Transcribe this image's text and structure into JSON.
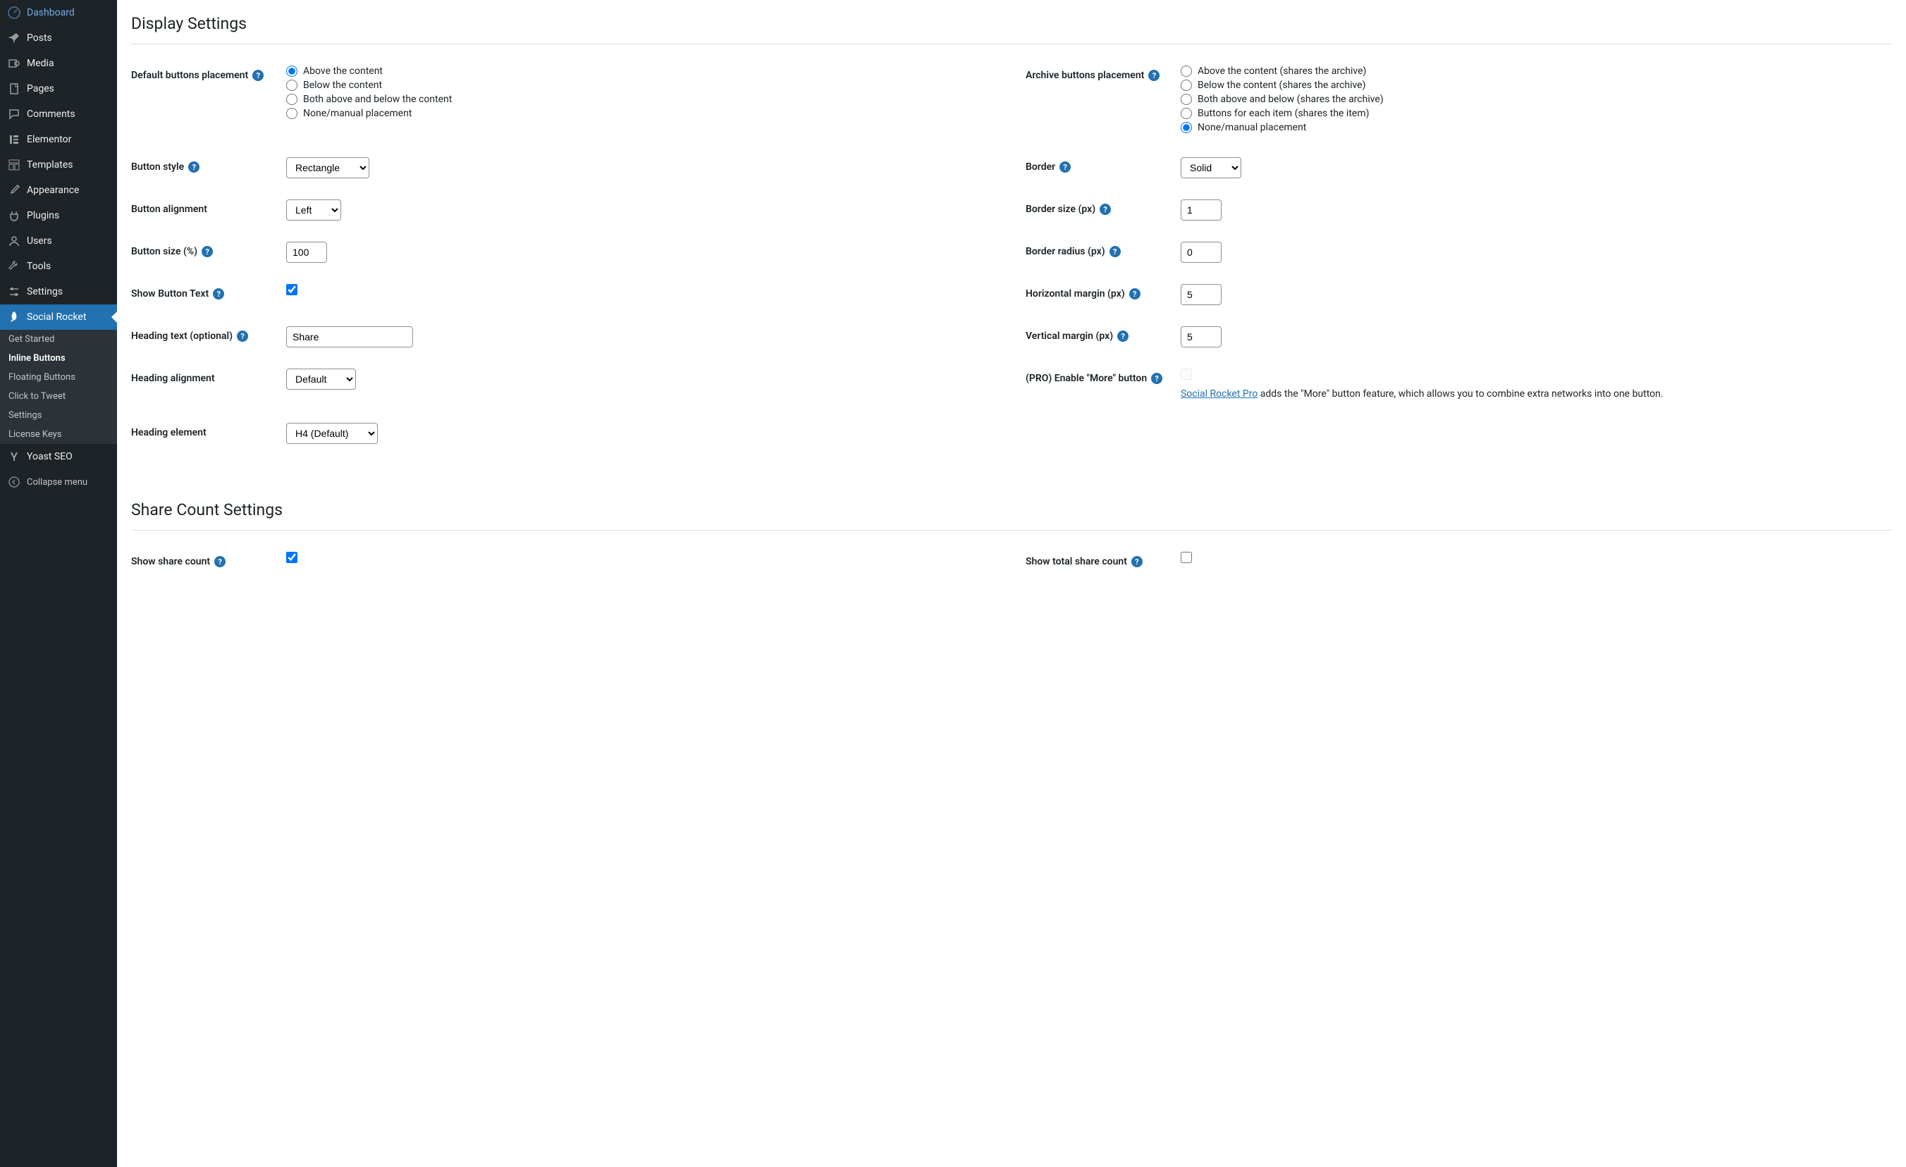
{
  "sidebar": {
    "items": [
      {
        "label": "Dashboard"
      },
      {
        "label": "Posts"
      },
      {
        "label": "Media"
      },
      {
        "label": "Pages"
      },
      {
        "label": "Comments"
      },
      {
        "label": "Elementor"
      },
      {
        "label": "Templates"
      },
      {
        "label": "Appearance"
      },
      {
        "label": "Plugins"
      },
      {
        "label": "Users"
      },
      {
        "label": "Tools"
      },
      {
        "label": "Settings"
      },
      {
        "label": "Social Rocket"
      },
      {
        "label": "Yoast SEO"
      }
    ],
    "submenu": [
      {
        "label": "Get Started"
      },
      {
        "label": "Inline Buttons"
      },
      {
        "label": "Floating Buttons"
      },
      {
        "label": "Click to Tweet"
      },
      {
        "label": "Settings"
      },
      {
        "label": "License Keys"
      }
    ],
    "collapse": "Collapse menu"
  },
  "sections": {
    "display": "Display Settings",
    "share_count": "Share Count Settings"
  },
  "labels": {
    "default_placement": "Default buttons placement",
    "archive_placement": "Archive buttons placement",
    "button_style": "Button style",
    "border": "Border",
    "button_alignment": "Button alignment",
    "border_size": "Border size (px)",
    "button_size": "Button size (%)",
    "border_radius": "Border radius (px)",
    "show_button_text": "Show Button Text",
    "horizontal_margin": "Horizontal margin (px)",
    "heading_text": "Heading text (optional)",
    "vertical_margin": "Vertical margin (px)",
    "heading_alignment": "Heading alignment",
    "pro_more": "(PRO) Enable \"More\" button",
    "heading_element": "Heading element",
    "show_share_count": "Show share count",
    "show_total_share_count": "Show total share count"
  },
  "radios": {
    "default": [
      "Above the content",
      "Below the content",
      "Both above and below the content",
      "None/manual placement"
    ],
    "archive": [
      "Above the content (shares the archive)",
      "Below the content (shares the archive)",
      "Both above and below (shares the archive)",
      "Buttons for each item (shares the item)",
      "None/manual placement"
    ]
  },
  "values": {
    "button_style": "Rectangle",
    "border": "Solid",
    "button_alignment": "Left",
    "border_size": "1",
    "button_size": "100",
    "border_radius": "0",
    "horizontal_margin": "5",
    "heading_text": "Share",
    "vertical_margin": "5",
    "heading_alignment": "Default",
    "heading_element": "H4 (Default)"
  },
  "pro": {
    "link_text": "Social Rocket Pro",
    "desc": " adds the \"More\" button feature, which allows you to combine extra networks into one button."
  },
  "help": "?"
}
